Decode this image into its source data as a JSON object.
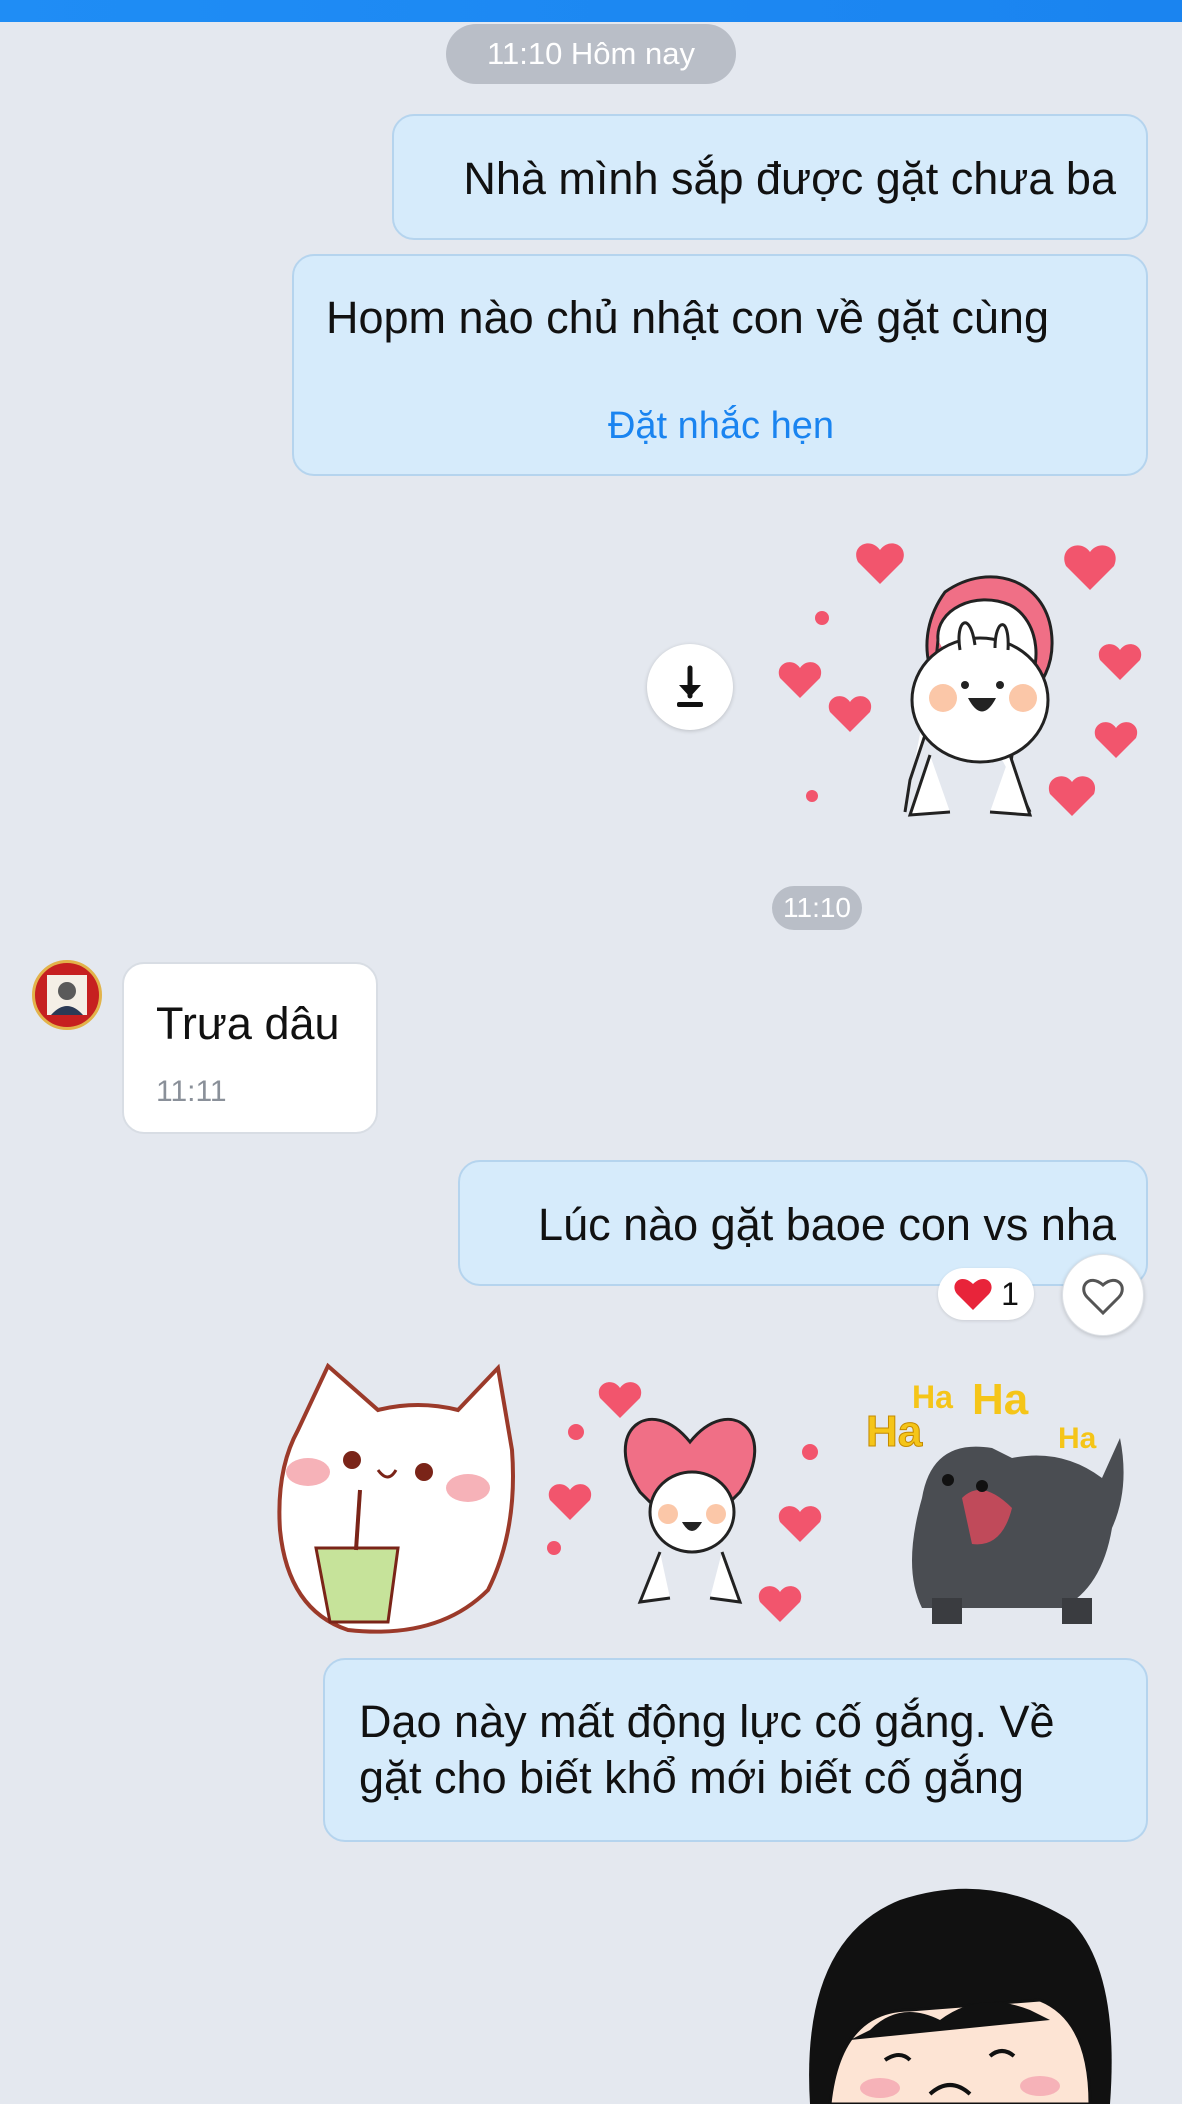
{
  "header": {
    "date_pill": "11:10 Hôm nay"
  },
  "messages": {
    "m1": {
      "text": "Nhà mình sắp được gặt chưa ba"
    },
    "m2": {
      "text": "Hopm nào chủ nhật con về gặt cùng",
      "action": "Đặt nhắc hẹn"
    },
    "time_pill": "11:10",
    "m3": {
      "text": "Trưa dâu",
      "time": "11:11"
    },
    "m4": {
      "text": "Lúc nào gặt baoe con vs nha",
      "reaction_count": "1"
    },
    "m5": {
      "line1": "Dạo này mất động lực cố gắng. Về",
      "line2": "gặt cho biết khổ mới biết cố gắng"
    }
  },
  "stickers": {
    "dog_text": "Ha"
  },
  "colors": {
    "accent": "#1a84f0",
    "bubble_out": "#d6ebfb",
    "background": "#e4e8ef",
    "heart": "#f2556d"
  }
}
